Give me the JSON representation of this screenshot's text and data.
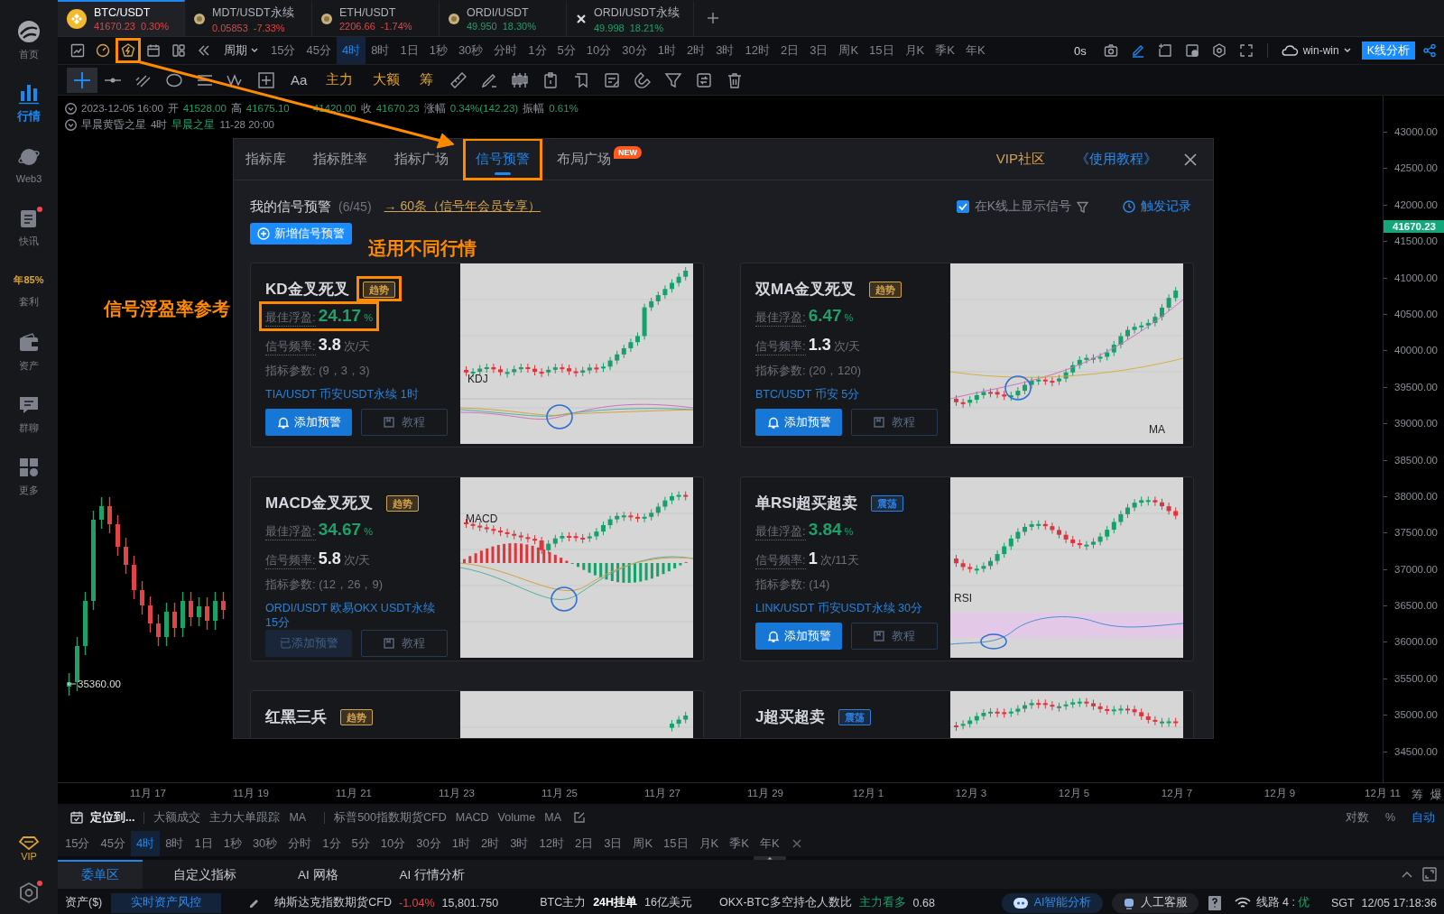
{
  "sidebar": {
    "items": [
      {
        "label": "首页",
        "selected": false,
        "dot": false
      },
      {
        "label": "行情",
        "selected": true,
        "dot": false
      },
      {
        "label": "Web3",
        "selected": false,
        "dot": false
      },
      {
        "label": "快讯",
        "selected": false,
        "dot": true
      },
      {
        "label": "套利",
        "badge": "年85%",
        "selected": false,
        "dot": false
      },
      {
        "label": "资产",
        "selected": false,
        "dot": false
      },
      {
        "label": "群聊",
        "selected": false,
        "dot": false
      },
      {
        "label": "更多",
        "selected": false,
        "dot": false
      }
    ],
    "vip": "VIP",
    "settings_dot": true
  },
  "symbol_tabs": [
    {
      "symbol": "BTC/USDT",
      "price": "41670.23",
      "change": "0.30%",
      "kind": "down",
      "selected": true
    },
    {
      "symbol": "MDT/USDT永续",
      "price": "0.05853",
      "change": "-7.33%",
      "kind": "down",
      "selected": false
    },
    {
      "symbol": "ETH/USDT",
      "price": "2206.66",
      "change": "-1.74%",
      "kind": "down",
      "selected": false
    },
    {
      "symbol": "ORDI/USDT",
      "price": "49.950",
      "change": "18.30%",
      "kind": "up",
      "selected": false
    },
    {
      "symbol": "ORDI/USDT永续",
      "price": "49.998",
      "change": "18.21%",
      "kind": "up",
      "selected": false
    }
  ],
  "toolbar": {
    "quick_icons": [
      {
        "highlighted": false
      },
      {
        "highlighted": false
      },
      {
        "highlighted": true
      },
      {
        "highlighted": false
      },
      {
        "highlighted": false
      }
    ],
    "period": "周期",
    "intervals": [
      {
        "label": "15分",
        "selected": false
      },
      {
        "label": "45分",
        "selected": false
      },
      {
        "label": "4时",
        "selected": true
      },
      {
        "label": "8时",
        "selected": false
      },
      {
        "label": "1日",
        "selected": false
      },
      {
        "label": "1秒",
        "selected": false
      },
      {
        "label": "30秒",
        "selected": false
      },
      {
        "label": "分时",
        "selected": false
      },
      {
        "label": "1分",
        "selected": false
      },
      {
        "label": "5分",
        "selected": false
      },
      {
        "label": "10分",
        "selected": false
      },
      {
        "label": "30分",
        "selected": false
      },
      {
        "label": "1时",
        "selected": false
      },
      {
        "label": "2时",
        "selected": false
      },
      {
        "label": "3时",
        "selected": false
      },
      {
        "label": "12时",
        "selected": false
      },
      {
        "label": "2日",
        "selected": false
      },
      {
        "label": "3日",
        "selected": false
      },
      {
        "label": "周K",
        "selected": false
      },
      {
        "label": "15日",
        "selected": false
      },
      {
        "label": "月K",
        "selected": false
      },
      {
        "label": "季K",
        "selected": false
      },
      {
        "label": "年K",
        "selected": false
      }
    ],
    "countdown": "0s",
    "account": "win-win",
    "analysis_button": "K线分析"
  },
  "drawing_tools": {
    "tools": [
      {
        "selected": true
      },
      {
        "selected": false
      },
      {
        "selected": false
      },
      {
        "selected": false
      },
      {
        "selected": false
      },
      {
        "selected": false
      },
      {
        "selected": false
      }
    ],
    "font_tool": "Aa",
    "text_tools": [
      "主力",
      "大额",
      "筹"
    ]
  },
  "chart": {
    "ohlc": {
      "date": "2023-12-05 16:00",
      "open_label": "开",
      "open": "41528.00",
      "high_label": "高",
      "high": "41675.10",
      "low": "41420.00",
      "close_label": "收",
      "close": "41670.23",
      "change_label": "涨幅",
      "change": "0.34%(142.23)",
      "amplitude_label": "振幅",
      "amplitude": "0.61%"
    },
    "pattern": {
      "name": "早晨黄昏之星",
      "interval": "4时",
      "signal": "早晨之星",
      "time": "11-28 20:00"
    },
    "price_axis": [
      "43000.00",
      "42500.00",
      "42000.00",
      "41500.00",
      "41000.00",
      "40500.00",
      "40000.00",
      "39500.00",
      "39000.00",
      "38500.00",
      "38000.00",
      "37500.00",
      "37000.00",
      "36500.00",
      "36000.00",
      "35500.00",
      "35000.00",
      "34500.00"
    ],
    "last_price": "41670.23",
    "low_marker": "35360.00",
    "date_axis": [
      "11月 17",
      "11月 19",
      "11月 21",
      "11月 23",
      "11月 25",
      "11月 27",
      "11月 29",
      "12月 1",
      "12月 3",
      "12月 5",
      "12月 7",
      "12月 9",
      "12月 11"
    ],
    "axis_buttons": [
      "筹",
      "爆"
    ]
  },
  "signal_modal": {
    "tabs": [
      {
        "label": "指标库",
        "selected": false,
        "highlighted": false
      },
      {
        "label": "指标胜率",
        "selected": false,
        "highlighted": false
      },
      {
        "label": "指标广场",
        "selected": false,
        "highlighted": false
      },
      {
        "label": "信号预警",
        "selected": true,
        "highlighted": true
      },
      {
        "label": "布局广场",
        "badge": "NEW",
        "selected": false,
        "highlighted": false
      }
    ],
    "vip_link": "VIP社区",
    "tutorial_link": "《使用教程》",
    "title": "我的信号预警",
    "count": "(6/45)",
    "upgrade_link": "→ 60条（信号年会员专享）",
    "add_button": "新增信号预警",
    "show_on_chart": {
      "label": "在K线上显示信号",
      "checked": true
    },
    "history_link": "触发记录",
    "cards": [
      {
        "title": "KD金叉死叉",
        "tag": "趋势",
        "color": "#d4a24c",
        "highlighted": true,
        "profit_label": "最佳浮盈:",
        "profit": "24.17",
        "profit_unit": "%",
        "freq_label": "信号频率:",
        "freq": "3.8",
        "freq_unit": "次/天",
        "params": "指标参数: (9，3，3)",
        "market": "TIA/USDT 币安USDT永续 1时",
        "add_label": "添加预警",
        "added": false,
        "tutorial": "教程",
        "kind": "kdj",
        "chart_label": "KDJ"
      },
      {
        "title": "双MA金叉死叉",
        "tag": "趋势",
        "color": "#d4a24c",
        "highlighted": false,
        "profit_label": "最佳浮盈:",
        "profit": "6.47",
        "profit_unit": "%",
        "freq_label": "信号频率:",
        "freq": "1.3",
        "freq_unit": "次/天",
        "params": "指标参数: (20，120)",
        "market": "BTC/USDT 币安 5分",
        "add_label": "添加预警",
        "added": false,
        "tutorial": "教程",
        "kind": "ma",
        "chart_label": "MA"
      },
      {
        "title": "MACD金叉死叉",
        "tag": "趋势",
        "color": "#d4a24c",
        "highlighted": false,
        "profit_label": "最佳浮盈:",
        "profit": "34.67",
        "profit_unit": "%",
        "freq_label": "信号频率:",
        "freq": "5.8",
        "freq_unit": "次/天",
        "params": "指标参数: (12，26，9)",
        "market": "ORDI/USDT 欧易OKX USDT永续 15分",
        "add_label": "已添加预警",
        "added": true,
        "tutorial": "教程",
        "kind": "macd",
        "chart_label": "MACD"
      },
      {
        "title": "单RSI超买超卖",
        "tag": "震荡",
        "color": "#2f7fe0",
        "highlighted": false,
        "profit_label": "最佳浮盈:",
        "profit": "3.84",
        "profit_unit": "%",
        "freq_label": "信号频率:",
        "freq": "1",
        "freq_unit": "次/11天",
        "params": "指标参数: (14)",
        "market": "LINK/USDT 币安USDT永续 30分",
        "add_label": "添加预警",
        "added": false,
        "tutorial": "教程",
        "kind": "rsi",
        "chart_label": "RSI"
      },
      {
        "title": "红黑三兵",
        "tag": "趋势",
        "color": "#d4a24c",
        "highlighted": false,
        "kind": "bars"
      },
      {
        "title": "J超买超卖",
        "tag": "震荡",
        "color": "#2f7fe0",
        "highlighted": false,
        "kind": "hump"
      }
    ]
  },
  "indicator_bar": {
    "locate": "定位到...",
    "main_indicators": [
      "大额成交",
      "主力大单跟踪",
      "MA"
    ],
    "sub_indicators": [
      "标普500指数期货CFD",
      "MACD",
      "Volume",
      "MA"
    ],
    "scale_options": [
      {
        "label": "对数",
        "selected": false
      },
      {
        "label": "%",
        "selected": false
      },
      {
        "label": "自动",
        "selected": true
      }
    ]
  },
  "interval_bar": {
    "intervals": [
      {
        "label": "15分",
        "selected": false
      },
      {
        "label": "45分",
        "selected": false
      },
      {
        "label": "4时",
        "selected": true
      },
      {
        "label": "8时",
        "selected": false
      },
      {
        "label": "1日",
        "selected": false
      },
      {
        "label": "1秒",
        "selected": false
      },
      {
        "label": "30秒",
        "selected": false
      },
      {
        "label": "分时",
        "selected": false
      },
      {
        "label": "1分",
        "selected": false
      },
      {
        "label": "5分",
        "selected": false
      },
      {
        "label": "10分",
        "selected": false
      },
      {
        "label": "30分",
        "selected": false
      },
      {
        "label": "1时",
        "selected": false
      },
      {
        "label": "2时",
        "selected": false
      },
      {
        "label": "3时",
        "selected": false
      },
      {
        "label": "12时",
        "selected": false
      },
      {
        "label": "2日",
        "selected": false
      },
      {
        "label": "3日",
        "selected": false
      },
      {
        "label": "周K",
        "selected": false
      },
      {
        "label": "15日",
        "selected": false
      },
      {
        "label": "月K",
        "selected": false
      },
      {
        "label": "季K",
        "selected": false
      },
      {
        "label": "年K",
        "selected": false
      }
    ]
  },
  "bottom_panel": {
    "tabs": [
      {
        "label": "委单区",
        "selected": true
      },
      {
        "label": "自定义指标",
        "selected": false
      },
      {
        "label": "AI 网格",
        "selected": false
      },
      {
        "label": "AI 行情分析",
        "selected": false
      }
    ]
  },
  "status_bar": {
    "assets_label": "资产($)",
    "risk_button": "实时资产风控",
    "index_name": "纳斯达克指数期货CFD",
    "index_change": "-1.04%",
    "index_value": "15,801.750",
    "main_label": "BTC主力",
    "orders_label": "24H挂单",
    "orders_value": "16亿美元",
    "ratio_label": "OKX-BTC多空持仓人数比",
    "ratio_signal": "主力看多",
    "ratio_value": "0.68",
    "ai_button": "AI智能分析",
    "support_button": "人工客服",
    "line_label": "线路 4 :",
    "line_quality": "优",
    "timezone": "SGT",
    "time": "12/05 17:18:36"
  },
  "annotations": [
    {
      "text": "信号浮盈率参考"
    },
    {
      "text": "适用不同行情"
    }
  ]
}
